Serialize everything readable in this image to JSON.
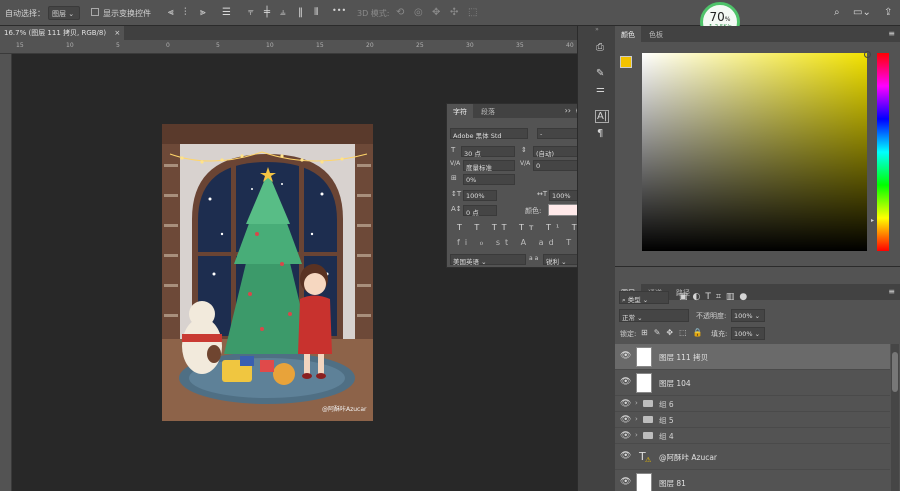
{
  "options_bar": {
    "auto_select_label": "自动选择：",
    "auto_select_value": "图层",
    "show_transform_label": "显示变换控件",
    "mode_3d_label": "3D 模式:",
    "more_label": "•••"
  },
  "network_badge": {
    "percent": "70",
    "percent_sign": "%",
    "speed": "↑ 2.5K/s"
  },
  "document": {
    "tab_title": "16.7% (图层 111 拷贝, RGB/8)",
    "close": "×",
    "ruler_ticks": [
      "15",
      "10",
      "5",
      "0",
      "5",
      "10",
      "15",
      "20",
      "25",
      "30",
      "35",
      "40"
    ],
    "watermark": "@阿酥咔Azucar"
  },
  "color_panel": {
    "tab_color": "颜色",
    "tab_swatches": "色板",
    "foreground_color": "#f2c200",
    "background_color": "#ffffff"
  },
  "character_panel": {
    "tab_char": "字符",
    "tab_para": "段落",
    "font_family": "Adobe 黑体 Std",
    "font_style": "-",
    "font_size": "30 点",
    "leading": "(自动)",
    "kerning": "度量标准",
    "tracking": "0",
    "tsume": "0%",
    "vertical_scale": "100%",
    "horizontal_scale": "100%",
    "baseline_shift": "0 点",
    "color_label": "颜色:",
    "text_color": "#ffe9e9",
    "language": "美国英语",
    "aa_label": "a a",
    "antialias": "锐利"
  },
  "layers_panel": {
    "tab_layers": "图层",
    "tab_channels": "通道",
    "tab_paths": "路径",
    "filter_kind": "类型",
    "blend_mode": "正常",
    "opacity_label": "不透明度:",
    "opacity_value": "100%",
    "lock_label": "锁定:",
    "fill_label": "填充:",
    "fill_value": "100%",
    "layers": [
      {
        "name": "图层 111 拷贝",
        "type": "pixel"
      },
      {
        "name": "图层 104",
        "type": "pixel"
      },
      {
        "name": "组 6",
        "type": "group"
      },
      {
        "name": "组 5",
        "type": "group"
      },
      {
        "name": "组 4",
        "type": "group"
      },
      {
        "name": "@阿酥咔 Azucar",
        "type": "text"
      },
      {
        "name": "图层 81",
        "type": "pixel"
      }
    ]
  }
}
